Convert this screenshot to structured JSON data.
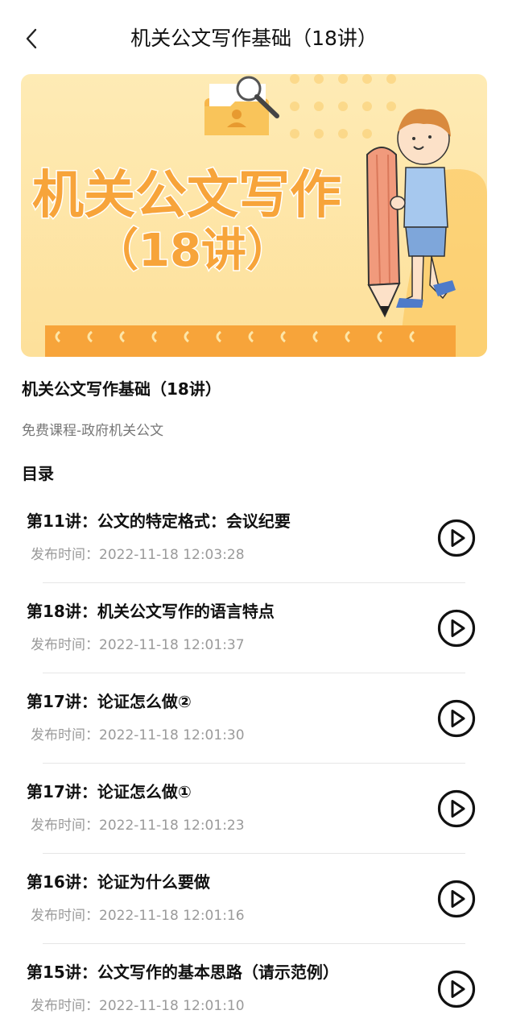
{
  "header": {
    "title": "机关公文写作基础（18讲）"
  },
  "banner": {
    "line1": "机关公文写作",
    "line2": "（18讲）"
  },
  "course": {
    "title": "机关公文写作基础（18讲）",
    "category": "免费课程-政府机关公文"
  },
  "catalog": {
    "heading": "目录",
    "items": [
      {
        "title": "第11讲：公文的特定格式：会议纪要",
        "time": "发布时间：2022-11-18 12:03:28"
      },
      {
        "title": "第18讲：机关公文写作的语言特点",
        "time": "发布时间：2022-11-18 12:01:37"
      },
      {
        "title": "第17讲：论证怎么做②",
        "time": "发布时间：2022-11-18 12:01:30"
      },
      {
        "title": "第17讲：论证怎么做①",
        "time": "发布时间：2022-11-18 12:01:23"
      },
      {
        "title": "第16讲：论证为什么要做",
        "time": "发布时间：2022-11-18 12:01:16"
      },
      {
        "title": "第15讲：公文写作的基本思路（请示范例）",
        "time": "发布时间：2022-11-18 12:01:10"
      }
    ]
  },
  "icons": {
    "back": "chevron-left-icon",
    "play": "play-circle-icon"
  },
  "colors": {
    "banner_bg": "#FDE6A8",
    "banner_text": "#F7A43A",
    "pencil": "#F19A7C"
  }
}
